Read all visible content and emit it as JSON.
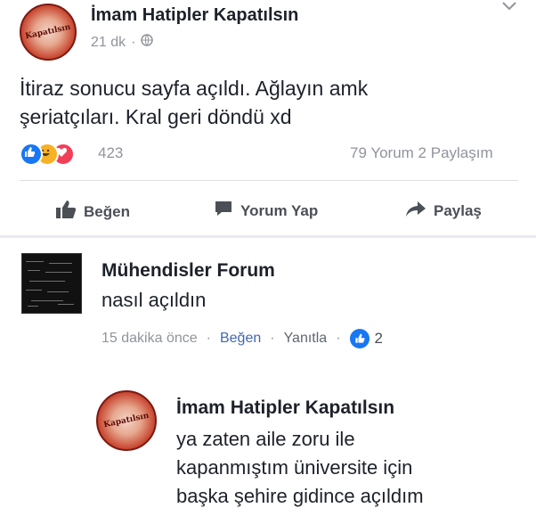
{
  "post": {
    "author": "İmam Hatipler Kapatılsın",
    "time": "21 dk",
    "separator": "·",
    "text_line1": "İtiraz sonucu sayfa açıldı. Ağlayın amk",
    "text_line2": "şeriatçıları. Kral geri döndü xd",
    "reaction_count": "423",
    "comments_shares": "79 Yorum 2 Paylaşım",
    "avatar_text": "Kapatılsın"
  },
  "actions": {
    "like": "Beğen",
    "comment": "Yorum Yap",
    "share": "Paylaş"
  },
  "comment1": {
    "author": "Mühendisler Forum",
    "text": "nasıl açıldın",
    "time": "15 dakika önce",
    "like": "Beğen",
    "reply": "Yanıtla",
    "likes": "2",
    "dot": "·"
  },
  "comment2": {
    "author": "İmam Hatipler Kapatılsın",
    "line1": "ya zaten aile zoru ile",
    "line2": "kapanmıştım üniversite için",
    "line3": "başka şehire gidince açıldım"
  },
  "colors": {
    "fb_blue": "#4267b2",
    "like_blue": "#1877f2",
    "haha_yellow": "#f7b125",
    "love_red": "#f33e58",
    "meta_gray": "#90949c"
  }
}
